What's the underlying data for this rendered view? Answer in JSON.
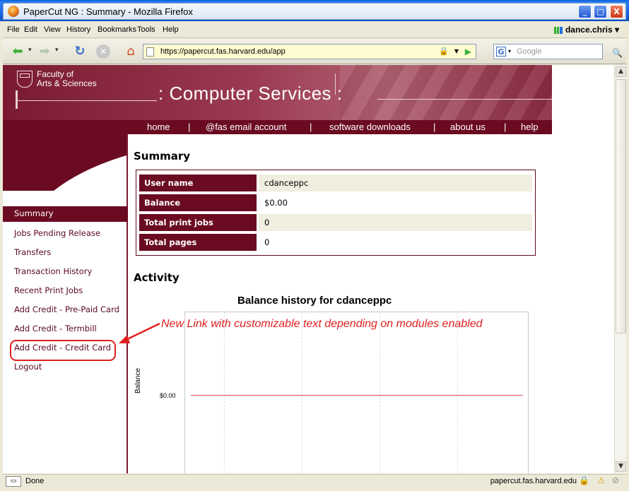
{
  "window": {
    "title": "PaperCut NG : Summary - Mozilla Firefox",
    "minimize": "_",
    "maximize": "□",
    "close": "X"
  },
  "menu": {
    "items": [
      "File",
      "Edit",
      "View",
      "History",
      "Bookmarks",
      "Tools",
      "Help"
    ],
    "user": "dance.chris"
  },
  "nav": {
    "url": "https://papercut.fas.harvard.edu/app",
    "search_placeholder": "Google"
  },
  "banner": {
    "org_line1": "Faculty of",
    "org_line2": "Arts & Sciences",
    "site_title": ": Computer Services :",
    "links": [
      "home",
      "@fas email account",
      "software downloads",
      "about us",
      "help"
    ]
  },
  "sidebar": {
    "items": [
      "Summary",
      "Jobs Pending Release",
      "Transfers",
      "Transaction History",
      "Recent Print Jobs",
      "Add Credit - Pre-Paid Card",
      "Add Credit - Termbill",
      "Add Credit - Credit Card",
      "Logout"
    ],
    "active_index": 0
  },
  "summary": {
    "heading": "Summary",
    "rows": [
      {
        "label": "User name",
        "value": "cdanceppc"
      },
      {
        "label": "Balance",
        "value": "$0.00"
      },
      {
        "label": "Total print jobs",
        "value": "0"
      },
      {
        "label": "Total pages",
        "value": "0"
      }
    ]
  },
  "activity": {
    "heading": "Activity",
    "chart_title": "Balance history for cdanceppc",
    "y_label": "Balance",
    "y_tick": "$0.00"
  },
  "chart_data": {
    "type": "line",
    "title": "Balance history for cdanceppc",
    "xlabel": "",
    "ylabel": "Balance",
    "series": [
      {
        "values": [
          0.0,
          0.0
        ]
      }
    ],
    "y_ticks": [
      "$0.00"
    ],
    "grid": true
  },
  "annotation": {
    "text": "New Link with customizable text depending on modules enabled",
    "color": "#e02020"
  },
  "status": {
    "text": "Done",
    "host": "papercut.fas.harvard.edu"
  },
  "colors": {
    "brand": "#6a0b22",
    "annotation": "#e02020"
  }
}
